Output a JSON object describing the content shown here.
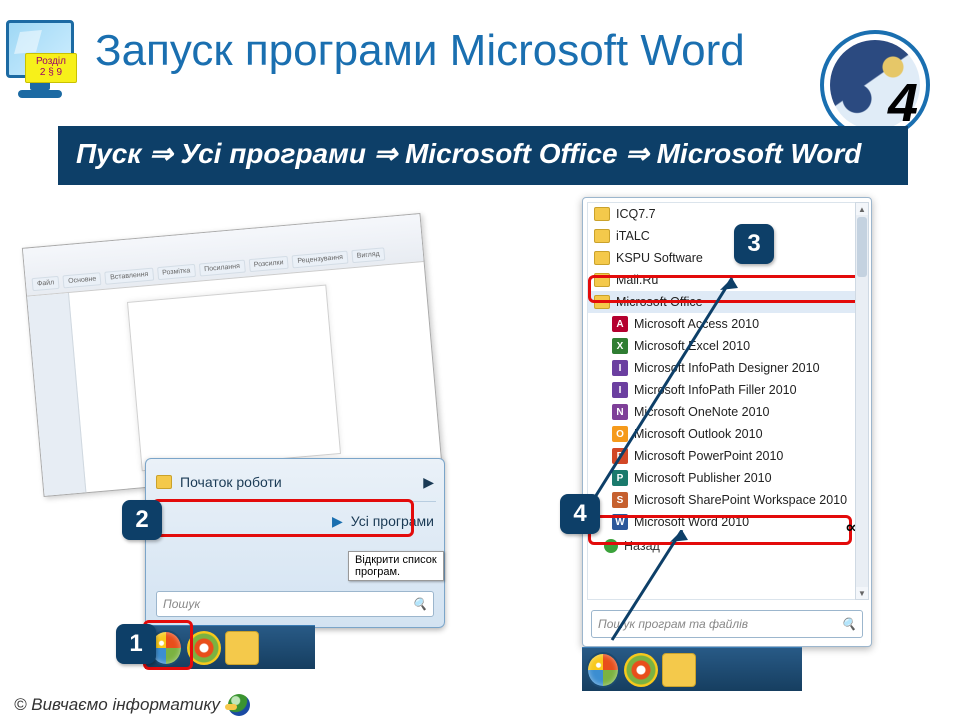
{
  "chapter_badge": {
    "line1": "Розділ",
    "line2": "2 § 9"
  },
  "title": "Запуск програми Microsoft Word",
  "slide_number": "4",
  "path_text": "Пуск ⇒ Усі програми ⇒ Microsoft Office ⇒ Microsoft Word",
  "word_tabs": [
    "Файл",
    "Основне",
    "Вставлення",
    "Розмітка",
    "Посилання",
    "Розсилки",
    "Рецензування",
    "Вигляд"
  ],
  "start_menu": {
    "row1": "Початок роботи",
    "row2": "Усі програми",
    "tooltip": "Відкрити список програм.",
    "search_placeholder": "Пошук"
  },
  "programs": {
    "top": [
      {
        "label": "ICQ7.7",
        "color": "#55b24b"
      },
      {
        "label": "iTALC",
        "color": "#222"
      },
      {
        "label": "KSPU Software",
        "color": "#222"
      },
      {
        "label": "Mail.Ru",
        "color": "#f59a1b"
      }
    ],
    "office_folder": "Microsoft Office",
    "office_items": [
      {
        "label": "Microsoft Access 2010",
        "letter": "A",
        "color": "#b4002f"
      },
      {
        "label": "Microsoft Excel 2010",
        "letter": "X",
        "color": "#2f7d32"
      },
      {
        "label": "Microsoft InfoPath Designer 2010",
        "letter": "I",
        "color": "#6b3fa0"
      },
      {
        "label": "Microsoft InfoPath Filler 2010",
        "letter": "I",
        "color": "#6b3fa0"
      },
      {
        "label": "Microsoft OneNote 2010",
        "letter": "N",
        "color": "#7e3f98"
      },
      {
        "label": "Microsoft Outlook 2010",
        "letter": "O",
        "color": "#f59a1b"
      },
      {
        "label": "Microsoft PowerPoint 2010",
        "letter": "P",
        "color": "#d24726"
      },
      {
        "label": "Microsoft Publisher 2010",
        "letter": "P",
        "color": "#1a7a6c"
      },
      {
        "label": "Microsoft SharePoint Workspace 2010",
        "letter": "S",
        "color": "#c6602e"
      },
      {
        "label": "Microsoft Word 2010",
        "letter": "W",
        "color": "#2b579a"
      }
    ],
    "back": "Назад",
    "search_placeholder": "Пошук програм та файлів"
  },
  "infinity_mark": "∞",
  "badges": {
    "n1": "1",
    "n2": "2",
    "n3": "3",
    "n4": "4"
  },
  "footer": "© Вивчаємо інформатику"
}
